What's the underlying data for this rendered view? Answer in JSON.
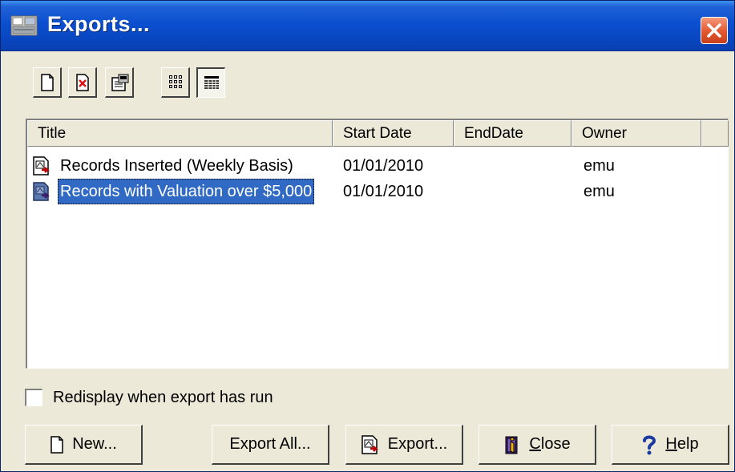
{
  "window": {
    "title": "Exports..."
  },
  "toolbar": {
    "buttons": [
      {
        "icon": "new-document-icon"
      },
      {
        "icon": "delete-document-icon"
      },
      {
        "icon": "properties-icon"
      },
      {
        "icon": "large-icons-view-icon"
      },
      {
        "icon": "details-view-icon",
        "pressed": true
      }
    ]
  },
  "list": {
    "columns": [
      "Title",
      "Start Date",
      "EndDate",
      "Owner",
      ""
    ],
    "rows": [
      {
        "title": "Records Inserted (Weekly Basis)",
        "start_date": "01/01/2010",
        "end_date": "",
        "owner": "emu",
        "selected": false
      },
      {
        "title": "Records with Valuation over $5,000",
        "start_date": "01/01/2010",
        "end_date": "",
        "owner": "emu",
        "selected": true
      }
    ]
  },
  "options": {
    "redisplay_label": "Redisplay when export has run",
    "redisplay_checked": false
  },
  "buttons": {
    "new": "New...",
    "export_all": "Export All...",
    "export": "Export...",
    "close_prefix": "C",
    "close_rest": "lose",
    "help_prefix": "H",
    "help_rest": "elp"
  },
  "colors": {
    "titlebar": "#0b4fd0",
    "selection": "#316ac5",
    "face": "#ece9d8",
    "close": "#e2562e"
  }
}
